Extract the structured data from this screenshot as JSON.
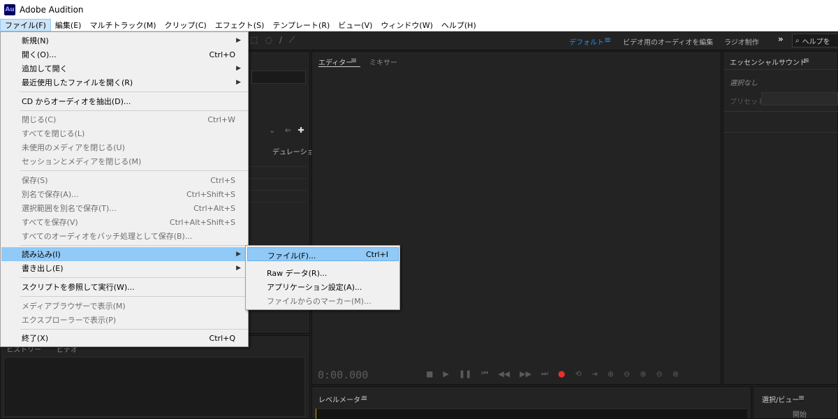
{
  "window": {
    "app_icon": "Au",
    "title": "Adobe Audition"
  },
  "menubar": {
    "items": [
      "ファイル(F)",
      "編集(E)",
      "マルチトラック(M)",
      "クリップ(C)",
      "エフェクト(S)",
      "テンプレート(R)",
      "ビュー(V)",
      "ウィンドウ(W)",
      "ヘルプ(H)"
    ],
    "active_index": 0
  },
  "toolbar": {
    "workspaces": [
      "デフォルト",
      "ビデオ用のオーディオを編集",
      "ラジオ制作"
    ],
    "active_workspace": "デフォルト",
    "more_label": "»",
    "help_search_placeholder": "ヘルプを"
  },
  "panels": {
    "left": {
      "duration_label": "デュレーション"
    },
    "editor": {
      "tab_editor": "エディター",
      "tab_mixer": "ミキサー",
      "menu_icon": "≡",
      "timecode": "0:00.000"
    },
    "essential_sound": {
      "title": "エッセンシャルサウンド",
      "no_selection": "選択なし",
      "preset_label": "プリセット :"
    },
    "level_meter": {
      "title": "レベルメーター"
    },
    "selection_view": {
      "title": "選択/ビュー",
      "start_label": "開始"
    },
    "bottom_left": {
      "tab1": "ヒストリー",
      "tab2": "ビデオ"
    }
  },
  "file_menu": {
    "items": [
      {
        "label": "新規(N)",
        "shortcut": "",
        "submenu": true,
        "disabled": false
      },
      {
        "label": "開く(O)...",
        "shortcut": "Ctrl+O",
        "submenu": false,
        "disabled": false
      },
      {
        "label": "追加して開く",
        "shortcut": "",
        "submenu": true,
        "disabled": false
      },
      {
        "label": "最近使用したファイルを開く(R)",
        "shortcut": "",
        "submenu": true,
        "disabled": false
      },
      {
        "label": "CD からオーディオを抽出(D)...",
        "shortcut": "",
        "submenu": false,
        "disabled": false
      },
      {
        "label": "閉じる(C)",
        "shortcut": "Ctrl+W",
        "submenu": false,
        "disabled": true
      },
      {
        "label": "すべてを閉じる(L)",
        "shortcut": "",
        "submenu": false,
        "disabled": true
      },
      {
        "label": "未使用のメディアを閉じる(U)",
        "shortcut": "",
        "submenu": false,
        "disabled": true
      },
      {
        "label": "セッションとメディアを閉じる(M)",
        "shortcut": "",
        "submenu": false,
        "disabled": true
      },
      {
        "label": "保存(S)",
        "shortcut": "Ctrl+S",
        "submenu": false,
        "disabled": true
      },
      {
        "label": "別名で保存(A)...",
        "shortcut": "Ctrl+Shift+S",
        "submenu": false,
        "disabled": true
      },
      {
        "label": "選択範囲を別名で保存(T)...",
        "shortcut": "Ctrl+Alt+S",
        "submenu": false,
        "disabled": true
      },
      {
        "label": "すべてを保存(V)",
        "shortcut": "Ctrl+Alt+Shift+S",
        "submenu": false,
        "disabled": true
      },
      {
        "label": "すべてのオーディオをバッチ処理として保存(B)...",
        "shortcut": "",
        "submenu": false,
        "disabled": true
      },
      {
        "label": "読み込み(I)",
        "shortcut": "",
        "submenu": true,
        "disabled": false,
        "highlighted": true
      },
      {
        "label": "書き出し(E)",
        "shortcut": "",
        "submenu": true,
        "disabled": false
      },
      {
        "label": "スクリプトを参照して実行(W)...",
        "shortcut": "",
        "submenu": false,
        "disabled": false
      },
      {
        "label": "メディアブラウザーで表示(M)",
        "shortcut": "",
        "submenu": false,
        "disabled": true
      },
      {
        "label": "エクスプローラーで表示(P)",
        "shortcut": "",
        "submenu": false,
        "disabled": true
      },
      {
        "label": "終了(X)",
        "shortcut": "Ctrl+Q",
        "submenu": false,
        "disabled": false
      }
    ]
  },
  "import_submenu": {
    "items": [
      {
        "label": "ファイル(F)...",
        "shortcut": "Ctrl+I",
        "disabled": false,
        "highlighted": true
      },
      {
        "label": "Raw データ(R)...",
        "shortcut": "",
        "disabled": false
      },
      {
        "label": "アプリケーション設定(A)...",
        "shortcut": "",
        "disabled": false
      },
      {
        "label": "ファイルからのマーカー(M)...",
        "shortcut": "",
        "disabled": true
      }
    ]
  },
  "colors": {
    "accent": "#2d8ceb",
    "menu_highlight": "#91c9f7",
    "record": "#e83030"
  }
}
